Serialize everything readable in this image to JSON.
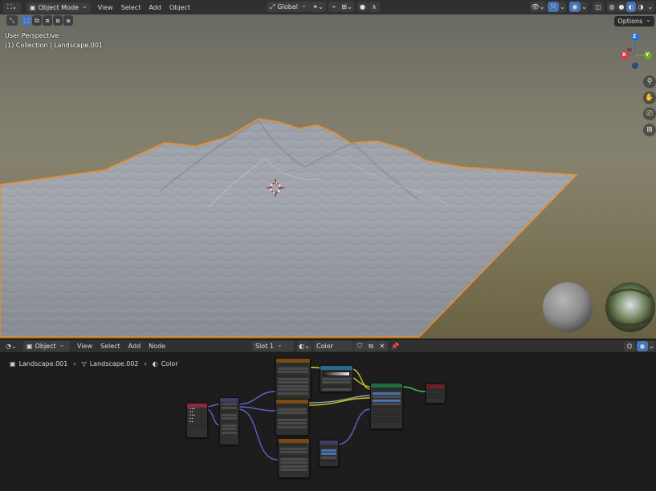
{
  "top_header": {
    "mode_label": "Object Mode",
    "menus": [
      "View",
      "Select",
      "Add",
      "Object"
    ],
    "orientation_label": "Global"
  },
  "viewport": {
    "perspective_label": "User Perspective",
    "collection_label": "(1) Collection | Landscape.001",
    "options_label": "Options",
    "gizmo": {
      "x": "X",
      "y": "Y",
      "z": "Z"
    }
  },
  "node_header": {
    "mode_label": "Object",
    "menus": [
      "View",
      "Select",
      "Add",
      "Node"
    ],
    "slot_label": "Slot 1",
    "material_name": "Color"
  },
  "breadcrumb": {
    "object": "Landscape.001",
    "mesh": "Landscape.002",
    "material": "Color"
  },
  "colors": {
    "header_bg": "#303030",
    "accent_blue": "#4772b3",
    "selection_orange": "#f08a24",
    "node_texture_header": "#7a4a12",
    "node_vector_header": "#3d3b69",
    "node_shader_header": "#1e6b3e",
    "node_input_header": "#8a2b3e",
    "node_converter_header": "#2a6a8a",
    "node_output_header": "#6b1f2b"
  }
}
